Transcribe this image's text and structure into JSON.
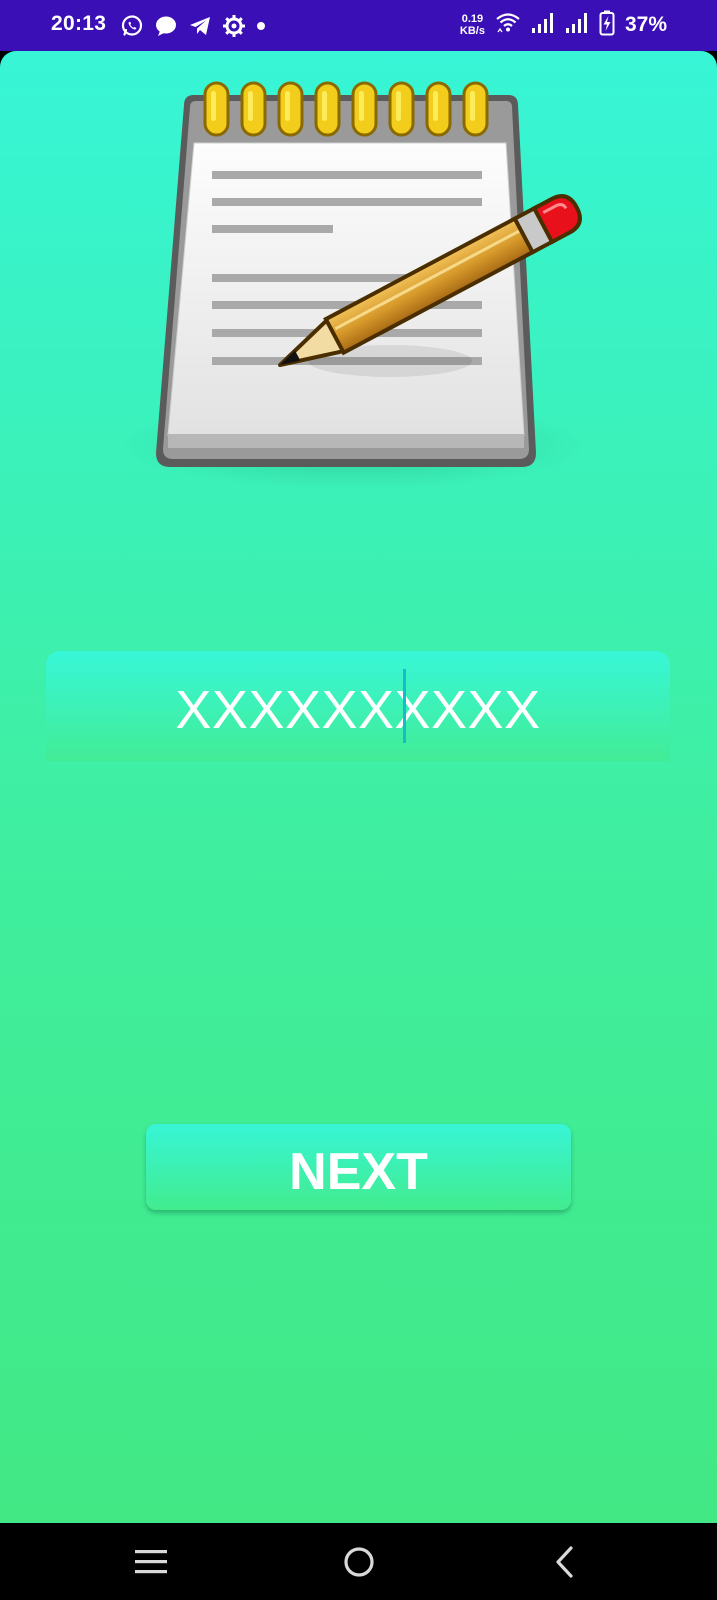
{
  "status_bar": {
    "time": "20:13",
    "net_speed_value": "0.19",
    "net_speed_unit": "KB/s",
    "battery_percent": "37%",
    "left_icons": [
      "whatsapp-icon",
      "message-icon",
      "telegram-icon",
      "settings-icon",
      "dot-icon"
    ],
    "right_icons": [
      "wifi-icon",
      "signal-icon",
      "signal-icon",
      "battery-icon"
    ],
    "background": "#3a0fb5"
  },
  "main": {
    "illustration": "notepad-pencil-icon",
    "number_field": {
      "value": "XXXXXXXXXX"
    },
    "next_button": {
      "label": "NEXT"
    },
    "colors": {
      "gradient_top": "#37f5d6",
      "gradient_bottom": "#42e884",
      "text": "#ffffff",
      "cursor": "#18bcc8"
    }
  },
  "nav_bar": {
    "buttons": [
      "menu-icon",
      "home-icon",
      "back-icon"
    ]
  }
}
